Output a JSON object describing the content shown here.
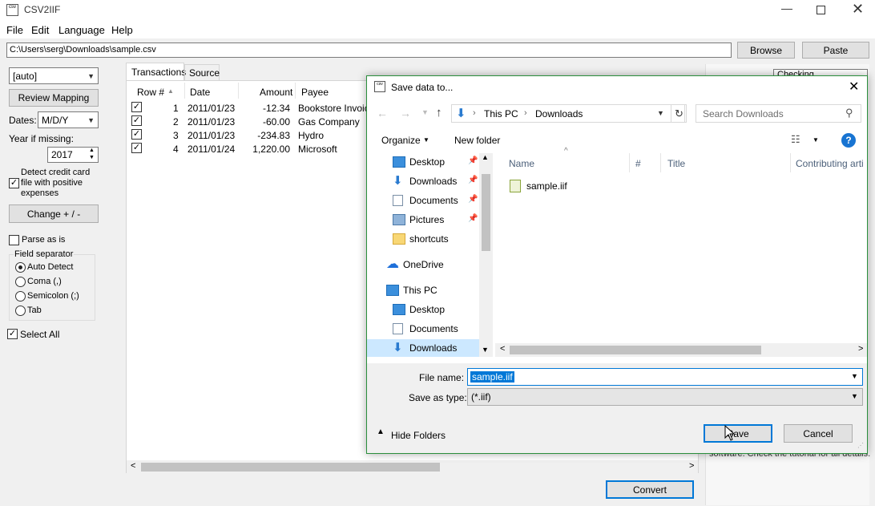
{
  "window": {
    "title": "CSV2IIF"
  },
  "menu": [
    "File",
    "Edit",
    "Language",
    "Help"
  ],
  "path_field": {
    "value": "C:\\Users\\serg\\Downloads\\sample.csv"
  },
  "browse_label": "Browse",
  "paste_label": "Paste",
  "left_panel": {
    "format_select": "[auto]",
    "review_mapping": "Review Mapping",
    "dates_label": "Dates:",
    "dates_value": "M/D/Y",
    "year_label": "Year if missing:",
    "year_value": "2017",
    "detect_label": "Detect credit card file with positive expenses",
    "change_label": "Change + / -",
    "parse_label": "Parse as is",
    "field_sep_label": "Field separator",
    "options": [
      "Auto Detect",
      "Coma (,)",
      "Semicolon (;)",
      "Tab"
    ],
    "selected_option": "Auto Detect",
    "select_all": "Select All"
  },
  "tabs": [
    "Transactions",
    "Source"
  ],
  "table": {
    "columns": [
      "Row #",
      "Date",
      "Amount",
      "Payee"
    ],
    "rows": [
      [
        "1",
        "2011/01/23",
        "-12.34",
        "Bookstore Invoice"
      ],
      [
        "2",
        "2011/01/23",
        "-60.00",
        "Gas Company"
      ],
      [
        "3",
        "2011/01/23",
        "-234.83",
        "Hydro"
      ],
      [
        "4",
        "2011/01/24",
        "1,220.00",
        "Microsoft"
      ]
    ]
  },
  "convert_label": "Convert",
  "right_panel": {
    "partial_top": "Checking",
    "partial_bottom": "software. Check the tutorial for all details."
  },
  "dialog": {
    "title": "Save data to...",
    "breadcrumb": [
      "This PC",
      "Downloads"
    ],
    "search_placeholder": "Search Downloads",
    "organize": "Organize",
    "new_folder": "New folder",
    "nav_items": [
      {
        "label": "Desktop",
        "icon": "desktop-icon",
        "pinned": true
      },
      {
        "label": "Downloads",
        "icon": "downloads-icon",
        "pinned": true
      },
      {
        "label": "Documents",
        "icon": "documents-icon",
        "pinned": true
      },
      {
        "label": "Pictures",
        "icon": "pictures-icon",
        "pinned": true
      },
      {
        "label": "shortcuts",
        "icon": "folder-icon",
        "pinned": false
      },
      {
        "label": "OneDrive",
        "icon": "onedrive-icon",
        "pinned": false
      },
      {
        "label": "This PC",
        "icon": "this-pc-icon",
        "pinned": false
      },
      {
        "label": "Desktop",
        "icon": "desktop-icon",
        "pinned": false
      },
      {
        "label": "Documents",
        "icon": "documents-icon",
        "pinned": false
      },
      {
        "label": "Downloads",
        "icon": "downloads-icon",
        "pinned": false
      }
    ],
    "columns": [
      "Name",
      "#",
      "Title",
      "Contributing arti"
    ],
    "files": [
      "sample.iif"
    ],
    "file_name_label": "File name:",
    "file_name_value": "sample.iif",
    "save_type_label": "Save as type:",
    "save_type_value": "(*.iif)",
    "hide_folders": "Hide Folders",
    "save_label": "Save",
    "cancel_label": "Cancel"
  },
  "colors": {
    "accent": "#0078d7",
    "selection": "#cce8ff",
    "dialog_border": "#2a8f3c"
  }
}
